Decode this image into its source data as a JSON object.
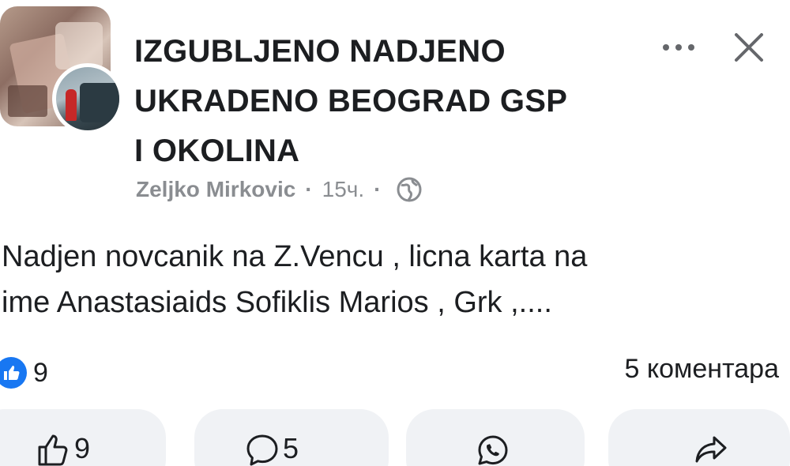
{
  "group": {
    "title_line1": "IZGUBLJENO NADJENO",
    "title_line2": "UKRADENO BEOGRAD GSP",
    "title_line3": "I OKOLINA"
  },
  "meta": {
    "author": "Zeljko Mirkovic",
    "separator": "·",
    "time": "15ч.",
    "privacy_icon": "globe-icon"
  },
  "post": {
    "text_line1": "Nadjen novcanik na Z.Vencu , licna karta na",
    "text_line2": "ime Anastasiaids Sofiklis Marios , Grk  ,...."
  },
  "stats": {
    "reaction_icon": "like-icon",
    "reaction_count": "9",
    "comments_label": "5 коментара"
  },
  "actions": {
    "like_count": "9",
    "comment_count": "5"
  },
  "colors": {
    "accent": "#1877f2",
    "muted_text": "#8a8d91",
    "button_bg": "#f0f2f5"
  }
}
